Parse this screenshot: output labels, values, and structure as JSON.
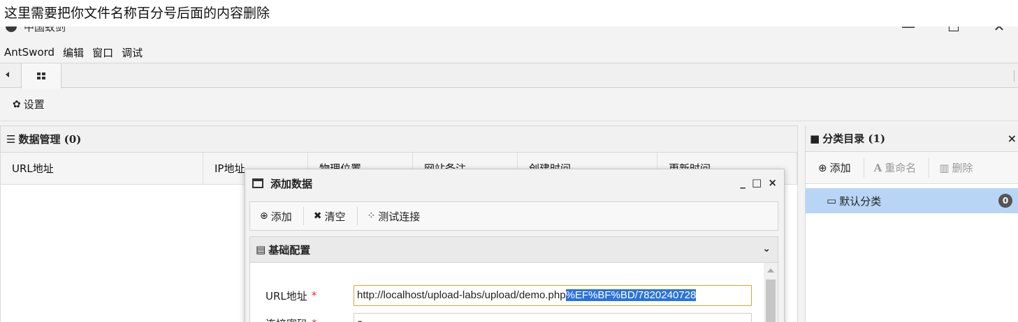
{
  "annotation": "这里需要把你文件名称百分号后面的内容删除",
  "window": {
    "title": "中国蚁剑",
    "minimize": "—",
    "maximize": "☐",
    "close": "✕"
  },
  "menu": [
    "AntSword",
    "编辑",
    "窗口",
    "调试"
  ],
  "toolbar": {
    "settings_icon": "gear-icon",
    "settings_label": "设置"
  },
  "data_panel": {
    "icon": "list-icon",
    "title": "数据管理 (0)",
    "columns": [
      "URL地址",
      "IP地址",
      "物理位置",
      "网站备注",
      "创建时间",
      "更新时间"
    ]
  },
  "category_panel": {
    "icon": "folder-icon",
    "title": "分类目录 (1)",
    "close": "×",
    "buttons": {
      "add": "添加",
      "rename": "重命名",
      "delete": "删除"
    },
    "items": [
      {
        "label": "默认分类",
        "count": "0"
      }
    ]
  },
  "dialog": {
    "title": "添加数据",
    "controls": "_ □ ×",
    "toolbar": {
      "add": "添加",
      "clear": "清空",
      "test": "测试连接"
    },
    "section": "基础配置",
    "fields": {
      "url_label": "URL地址",
      "url_required": "*",
      "url_value_plain": "http://localhost/upload-labs/upload/demo.php",
      "url_value_selected": "%EF%BF%BD/7820240728",
      "password_label": "连接密码",
      "password_required": "*",
      "password_value": "a"
    }
  },
  "colors": {
    "selection": "#2b73d8",
    "selected_category": "#b9d5f5",
    "required": "#e03030",
    "focus_border": "#e6a23c"
  }
}
